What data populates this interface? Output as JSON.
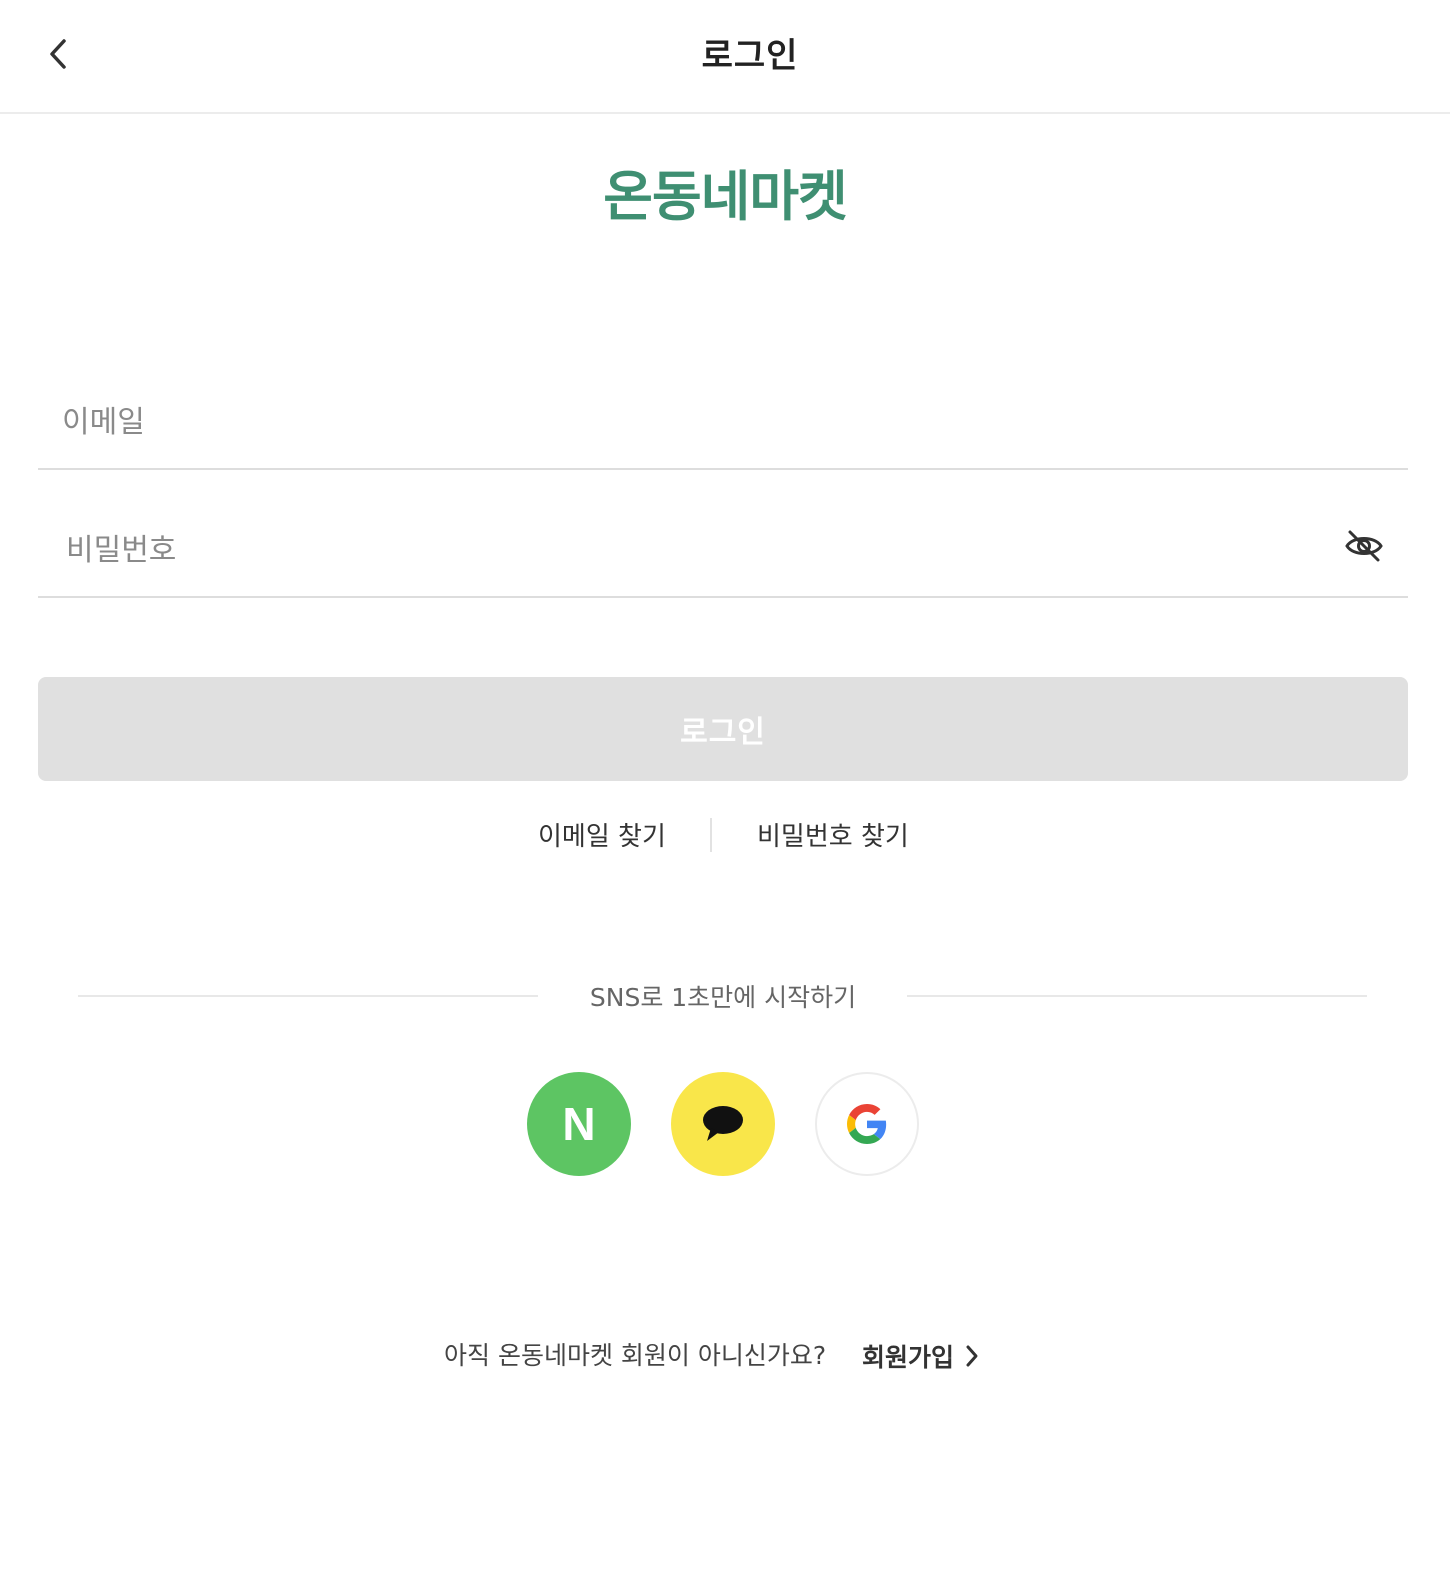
{
  "header": {
    "title": "로그인",
    "back_icon": "chevron-left-icon"
  },
  "brand": {
    "logo_text": "온동네마켓",
    "color": "#3f8f72"
  },
  "form": {
    "email_placeholder": "이메일",
    "email_value": "",
    "password_placeholder": "비밀번호",
    "password_value": "",
    "password_visibility_icon": "eye-off-icon",
    "login_button_label": "로그인",
    "login_button_state": "disabled"
  },
  "find_links": {
    "email": "이메일 찾기",
    "password": "비밀번호 찾기"
  },
  "sns": {
    "label": "SNS로 1초만에 시작하기",
    "providers": [
      {
        "name": "naver",
        "letter": "N",
        "color": "#5dc563",
        "icon": "naver-icon"
      },
      {
        "name": "kakao",
        "color": "#f9e64a",
        "icon": "kakao-speech-bubble-icon"
      },
      {
        "name": "google",
        "color": "#ffffff",
        "icon": "google-g-icon"
      }
    ]
  },
  "signup": {
    "prompt": "아직 온동네마켓 회원이 아니신가요?",
    "link_label": "회원가입",
    "link_icon": "chevron-right-icon"
  }
}
